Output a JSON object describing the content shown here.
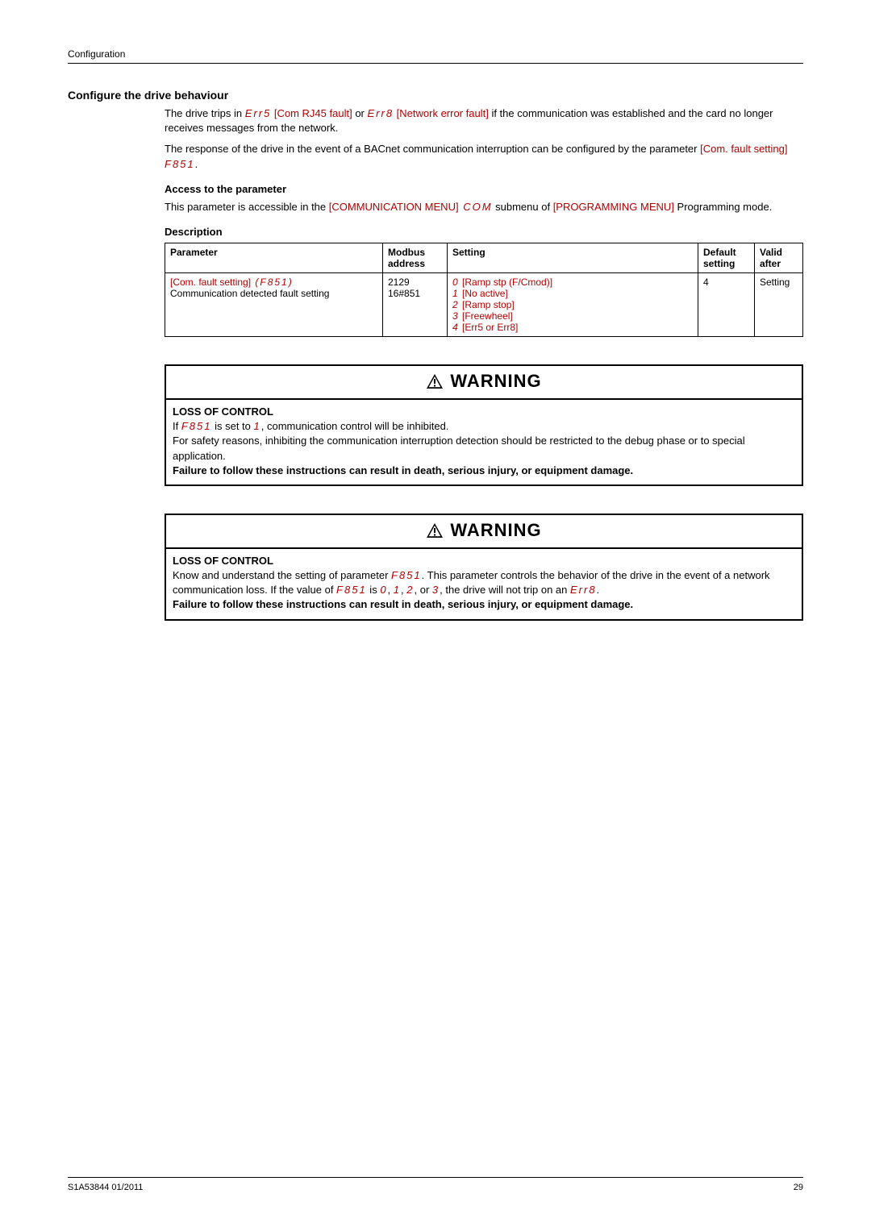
{
  "header": {
    "section": "Configuration"
  },
  "section": {
    "title": "Configure the drive behaviour",
    "p1_a": "The drive trips in ",
    "p1_code1": "Err5",
    "p1_link1": " [Com RJ45 fault]",
    "p1_b": " or ",
    "p1_code2": "Err8",
    "p1_link2": " [Network error fault]",
    "p1_c": " if the communication was established and the card no longer receives messages from the network.",
    "p2_a": "The response of the drive in the event of a BACnet communication interruption can be configured by the parameter ",
    "p2_link": "[Com. fault setting]",
    "p2_code": " F851",
    "p2_b": ".",
    "access_h": "Access to the parameter",
    "access_a": "This parameter is accessible in the ",
    "access_link1": "[COMMUNICATION MENU]",
    "access_code": " COM",
    "access_b": " submenu of ",
    "access_link2": "[PROGRAMMING MENU]",
    "access_c": " Programming mode.",
    "desc_h": "Description"
  },
  "table": {
    "head": {
      "param": "Parameter",
      "modbus": "Modbus address",
      "setting": "Setting",
      "default": "Default setting",
      "valid": "Valid after"
    },
    "row": {
      "param_link": "[Com. fault setting]",
      "param_code": " (F851)",
      "param_rest": "Communication detected fault setting",
      "modbus1": "2129",
      "modbus2": "16#851",
      "s0c": "0",
      "s0t": " [Ramp stp (F/Cmod)]",
      "s1c": "1",
      "s1t": " [No active]",
      "s2c": "2",
      "s2t": " [Ramp stop]",
      "s3c": "3",
      "s3t": " [Freewheel]",
      "s4c": "4",
      "s4t": " [Err5 or Err8]",
      "default": "4",
      "valid": "Setting"
    }
  },
  "warn1": {
    "head": "WARNING",
    "title": "LOSS OF CONTROL",
    "l1a": "If ",
    "l1code": "F851",
    "l1b": " is set to  ",
    "l1code2": "1",
    "l1c": ", communication control will be inhibited.",
    "l2": "For safety reasons, inhibiting the communication interruption detection should be restricted to the debug phase or to special application.",
    "l3": "Failure to follow these instructions can result in death, serious injury, or equipment damage."
  },
  "warn2": {
    "head": "WARNING",
    "title": "LOSS OF CONTROL",
    "l1a": "Know and understand the setting of parameter ",
    "l1code": "F851",
    "l1b": ". This parameter controls the behavior of the drive in the event of a network communication loss. If the value of ",
    "l1code2": "F851",
    "l1c": " is ",
    "v0": "0",
    "c0": ",  ",
    "v1": "1",
    "c1": ", ",
    "v2": "2",
    "c2": ", or ",
    "v3": "3",
    "l1d": ", the drive will not trip on an ",
    "l1code3": "Err8",
    "l1e": ".",
    "l2": "Failure to follow these instructions can result in death, serious injury, or equipment damage."
  },
  "footer": {
    "left": "S1A53844 01/2011",
    "right": "29"
  }
}
